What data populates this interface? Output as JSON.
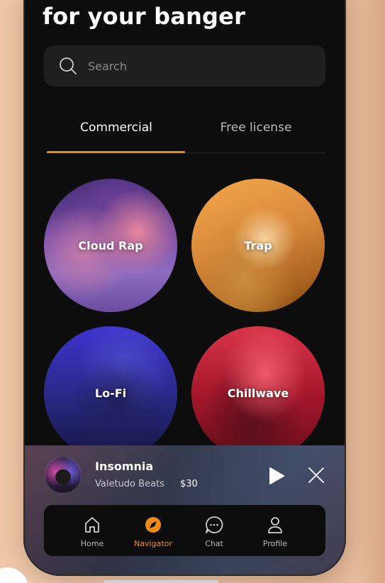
{
  "header": {
    "title": "for your banger"
  },
  "search": {
    "placeholder": "Search"
  },
  "tabs": [
    {
      "label": "Commercial",
      "active": true
    },
    {
      "label": "Free license",
      "active": false
    }
  ],
  "genres": [
    {
      "label": "Cloud Rap"
    },
    {
      "label": "Trap"
    },
    {
      "label": "Lo-Fi"
    },
    {
      "label": "Chillwave"
    }
  ],
  "player": {
    "title": "Insomnia",
    "artist": "Valetudo Beats",
    "price": "$30"
  },
  "nav": [
    {
      "label": "Home",
      "icon": "home-icon"
    },
    {
      "label": "Navigator",
      "icon": "navigator-icon",
      "active": true
    },
    {
      "label": "Chat",
      "icon": "chat-icon"
    },
    {
      "label": "Profile",
      "icon": "profile-icon"
    }
  ],
  "colors": {
    "accent": "#f08a1a",
    "background": "#0d0d0d"
  }
}
